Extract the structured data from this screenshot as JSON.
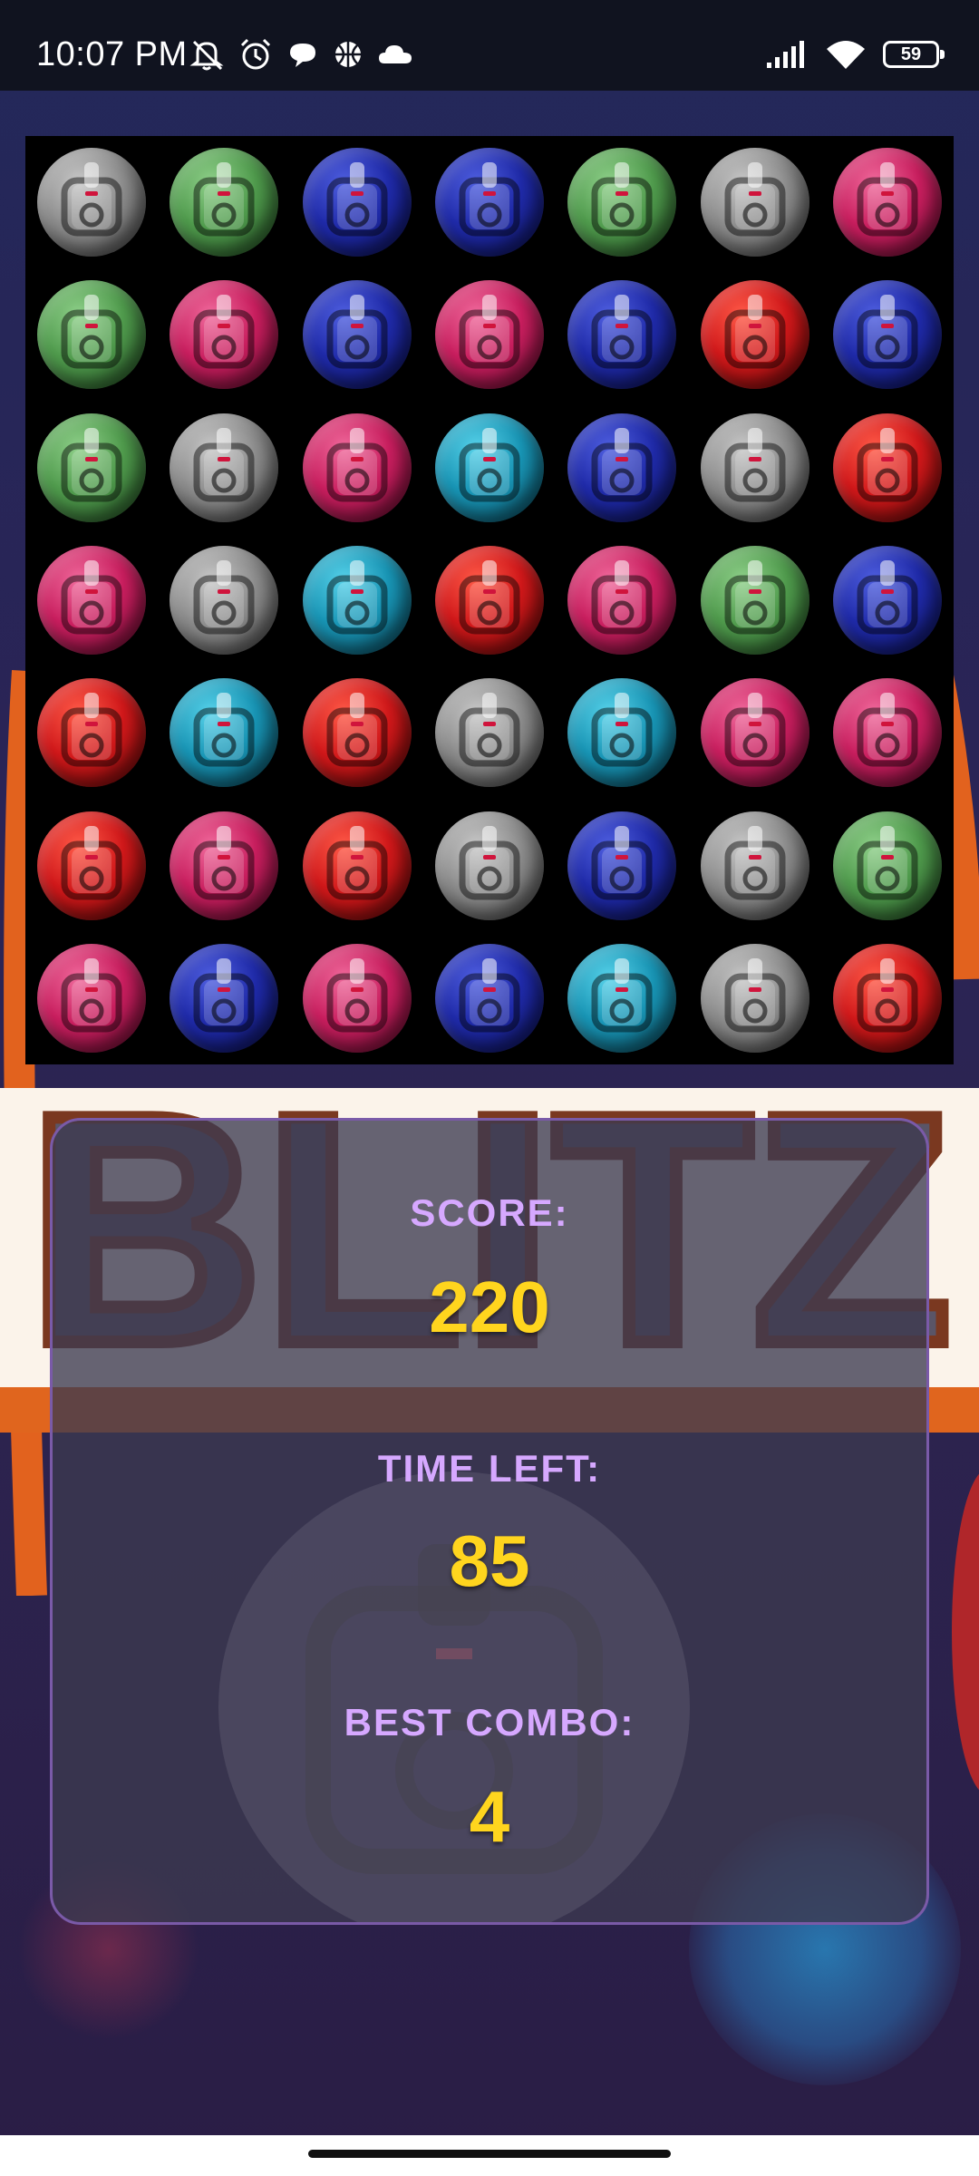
{
  "status_bar": {
    "time": "10:07 PM",
    "battery": "59",
    "left_icons": [
      "mute-bell-icon",
      "alarm-icon",
      "chat-bubble-icon",
      "basketball-icon",
      "cloud-icon"
    ],
    "right_icons": [
      "signal-icon",
      "wifi-icon",
      "battery-icon"
    ]
  },
  "background": {
    "title_word": "BLITZ"
  },
  "board": {
    "rows": [
      [
        "gray",
        "green",
        "blue",
        "blue",
        "green",
        "gray",
        "pink"
      ],
      [
        "green",
        "pink",
        "blue",
        "pink",
        "blue",
        "red",
        "blue"
      ],
      [
        "green",
        "gray",
        "pink",
        "cyan",
        "blue",
        "gray",
        "red"
      ],
      [
        "pink",
        "gray",
        "cyan",
        "red",
        "pink",
        "green",
        "blue"
      ],
      [
        "red",
        "cyan",
        "red",
        "gray",
        "cyan",
        "pink",
        "pink"
      ],
      [
        "red",
        "pink",
        "red",
        "gray",
        "blue",
        "gray",
        "green"
      ],
      [
        "pink",
        "blue",
        "pink",
        "blue",
        "cyan",
        "gray",
        "red"
      ]
    ],
    "gem_icon": "camera-backpack-icon"
  },
  "stats": {
    "score_label": "SCORE:",
    "score_value": "220",
    "time_label": "TIME LEFT:",
    "time_value": "85",
    "combo_label": "BEST COMBO:",
    "combo_value": "4"
  },
  "colors": {
    "label": "#d6a8ff",
    "value": "#ffd51e",
    "panel_border": "#7a5aa8"
  }
}
